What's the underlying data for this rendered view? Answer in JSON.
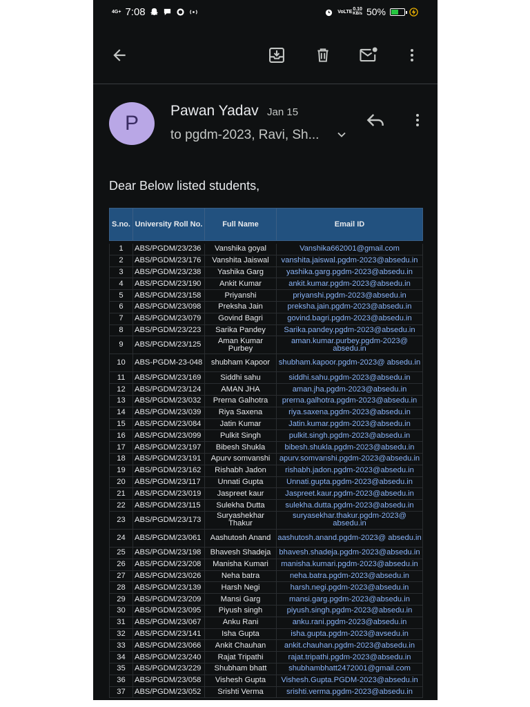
{
  "status_bar": {
    "network": "4G+",
    "time": "7:08",
    "volte": "VoLTE",
    "speed_value": "0.10",
    "speed_unit": "KB/s",
    "battery": "50%"
  },
  "toolbar": {
    "back_icon": "arrow-back-icon",
    "archive_icon": "archive-icon",
    "delete_icon": "trash-icon",
    "mark_unread_icon": "mail-unread-icon",
    "more_icon": "more-vert-icon"
  },
  "email": {
    "avatar_letter": "P",
    "sender": "Pawan Yadav",
    "date": "Jan 15",
    "recipients": "to pgdm-2023, Ravi, Sh...",
    "greeting": "Dear Below listed students,"
  },
  "colors": {
    "background": "#0f1112",
    "avatar": "#b9a7e6",
    "table_header": "#22517f",
    "link": "#8ab4f8"
  },
  "table": {
    "headers": [
      "S.no.",
      "University Roll No.",
      "Full Name",
      "Email ID"
    ],
    "rows": [
      {
        "sno": "1",
        "roll": "ABS/PGDM/23/236",
        "name": "Vanshika goyal",
        "email": "Vanshika662001@gmail.com"
      },
      {
        "sno": "2",
        "roll": "ABS/PGDM/23/176",
        "name": "Vanshita Jaiswal",
        "email": "vanshita.jaiswal.pgdm-2023@absedu.in"
      },
      {
        "sno": "3",
        "roll": "ABS/PGDM/23/238",
        "name": "Yashika Garg",
        "email": "yashika.garg.pgdm-2023@absedu.in"
      },
      {
        "sno": "4",
        "roll": "ABS/PGDM/23/190",
        "name": "Ankit Kumar",
        "email": "ankit.kumar.pgdm-2023@absedu.in"
      },
      {
        "sno": "5",
        "roll": "ABS/PGDM/23/158",
        "name": "Priyanshi",
        "email": "priyanshi.pgdm-2023@absedu.in"
      },
      {
        "sno": "6",
        "roll": "ABS/PGDM/23/098",
        "name": "Preksha Jain",
        "email": "preksha.jain.pgdm-2023@absedu.in"
      },
      {
        "sno": "7",
        "roll": "ABS/PGDM/23/079",
        "name": "Govind Bagri",
        "email": "govind.bagri.pgdm-2023@absedu.in"
      },
      {
        "sno": "8",
        "roll": "ABS/PGDM/23/223",
        "name": "Sarika Pandey",
        "email": "Sarika.pandey.pgdm-2023@absedu.in"
      },
      {
        "sno": "9",
        "roll": "ABS/PGDM/23/125",
        "name": "Aman Kumar Purbey",
        "email": "aman.kumar.purbey.pgdm-2023@ absedu.in",
        "tall": true
      },
      {
        "sno": "10",
        "roll": "ABS-PGDM-23-048",
        "name": "shubham Kapoor",
        "email": "shubham.kapoor.pgdm-2023@ absedu.in",
        "tall": true
      },
      {
        "sno": "11",
        "roll": "ABS/PGDM/23/169",
        "name": "Siddhi sahu",
        "email": "siddhi.sahu.pgdm-2023@absedu.in"
      },
      {
        "sno": "12",
        "roll": "ABS/PGDM/23/124",
        "name": "AMAN JHA",
        "email": "aman.jha.pgdm-2023@absedu.in"
      },
      {
        "sno": "13",
        "roll": "ABS/PGDM/23/032",
        "name": "Prerna Galhotra",
        "email": "prerna.galhotra.pgdm-2023@absedu.in"
      },
      {
        "sno": "14",
        "roll": "ABS/PGDM/23/039",
        "name": "Riya Saxena",
        "email": "riya.saxena.pgdm-2023@absedu.in"
      },
      {
        "sno": "15",
        "roll": "ABS/PGDM/23/084",
        "name": "Jatin Kumar",
        "email": "Jatin.kumar.pgdm-2023@absedu.in"
      },
      {
        "sno": "16",
        "roll": "ABS/PGDM/23/099",
        "name": "Pulkit Singh",
        "email": "pulkit.singh.pgdm-2023@absedu.in"
      },
      {
        "sno": "17",
        "roll": "ABS/PGDM/23/197",
        "name": "Bibesh Shukla",
        "email": "bibesh.shukla.pgdm-2023@absedu.in"
      },
      {
        "sno": "18",
        "roll": "ABS/PGDM/23/191",
        "name": "Apurv somvanshi",
        "email": "apurv.somvanshi.pgdm-2023@absedu.in"
      },
      {
        "sno": "19",
        "roll": "ABS/PGDM/23/162",
        "name": "Rishabh Jadon",
        "email": "rishabh.jadon.pgdm-2023@absedu.in"
      },
      {
        "sno": "20",
        "roll": "ABS/PGDM/23/117",
        "name": "Unnati Gupta",
        "email": "Unnati.gupta.pgdm-2023@absedu.in"
      },
      {
        "sno": "21",
        "roll": "ABS/PGDM/23/019",
        "name": "Jaspreet kaur",
        "email": "Jaspreet.kaur.pgdm-2023@absedu.in"
      },
      {
        "sno": "22",
        "roll": "ABS/PGDM/23/115",
        "name": "Sulekha Dutta",
        "email": "sulekha.dutta.pgdm-2023@absedu.in"
      },
      {
        "sno": "23",
        "roll": "ABS/PGDM/23/173",
        "name": "Suryashekhar Thakur",
        "email": "suryasekhar.thakur.pgdm-2023@ absedu.in",
        "tall": true
      },
      {
        "sno": "24",
        "roll": "ABS/PGDM/23/061",
        "name": "Aashutosh Anand",
        "email": "aashutosh.anand.pgdm-2023@ absedu.in",
        "tall": true
      },
      {
        "sno": "25",
        "roll": "ABS/PGDM/23/198",
        "name": "Bhavesh Shadeja",
        "email": "bhavesh.shadeja.pgdm-2023@absedu.in"
      },
      {
        "sno": "26",
        "roll": "ABS/PGDM/23/208",
        "name": "Manisha Kumari",
        "email": "manisha.kumari.pgdm-2023@absedu.in"
      },
      {
        "sno": "27",
        "roll": "ABS/PGDM/23/026",
        "name": "Neha batra",
        "email": "neha.batra.pgdm-2023@absedu.in"
      },
      {
        "sno": "28",
        "roll": "ABS/PGDM/23/139",
        "name": "Harsh Negi",
        "email": "harsh.negi.pgdm-2023@absedu.in"
      },
      {
        "sno": "29",
        "roll": "ABS/PGDM/23/209",
        "name": "Mansi Garg",
        "email": "mansi.garg.pgdm-2023@absedu.in"
      },
      {
        "sno": "30",
        "roll": "ABS/PGDM/23/095",
        "name": "Piyush singh",
        "email": "piyush.singh.pgdm-2023@absedu.in"
      },
      {
        "sno": "31",
        "roll": "ABS/PGDM/23/067",
        "name": "Anku Rani",
        "email": "anku.rani.pgdm-2023@absedu.in"
      },
      {
        "sno": "32",
        "roll": "ABS/PGDM/23/141",
        "name": "Isha Gupta",
        "email": "isha.gupta.pgdm-2023@avsedu.in"
      },
      {
        "sno": "33",
        "roll": "ABS/PGDM/23/066",
        "name": "Ankit Chauhan",
        "email": "ankit.chauhan.pgdm-2023@absedu.in"
      },
      {
        "sno": "34",
        "roll": "ABS/PGDM/23/240",
        "name": "Rajat Tripathi",
        "email": "rajat.tripathi.pgdm-2023@absedu.in"
      },
      {
        "sno": "35",
        "roll": "ABS/PGDM/23/229",
        "name": "Shubham bhatt",
        "email": "shubhambhatt2472001@gmail.com"
      },
      {
        "sno": "36",
        "roll": "ABS/PGDM/23/058",
        "name": "Vishesh Gupta",
        "email": "Vishesh.Gupta.PGDM-2023@absedu.in"
      },
      {
        "sno": "37",
        "roll": "ABS/PGDM/23/052",
        "name": "Srishti Verma",
        "email": "srishti.verma.pgdm-2023@absedu.in"
      }
    ]
  }
}
